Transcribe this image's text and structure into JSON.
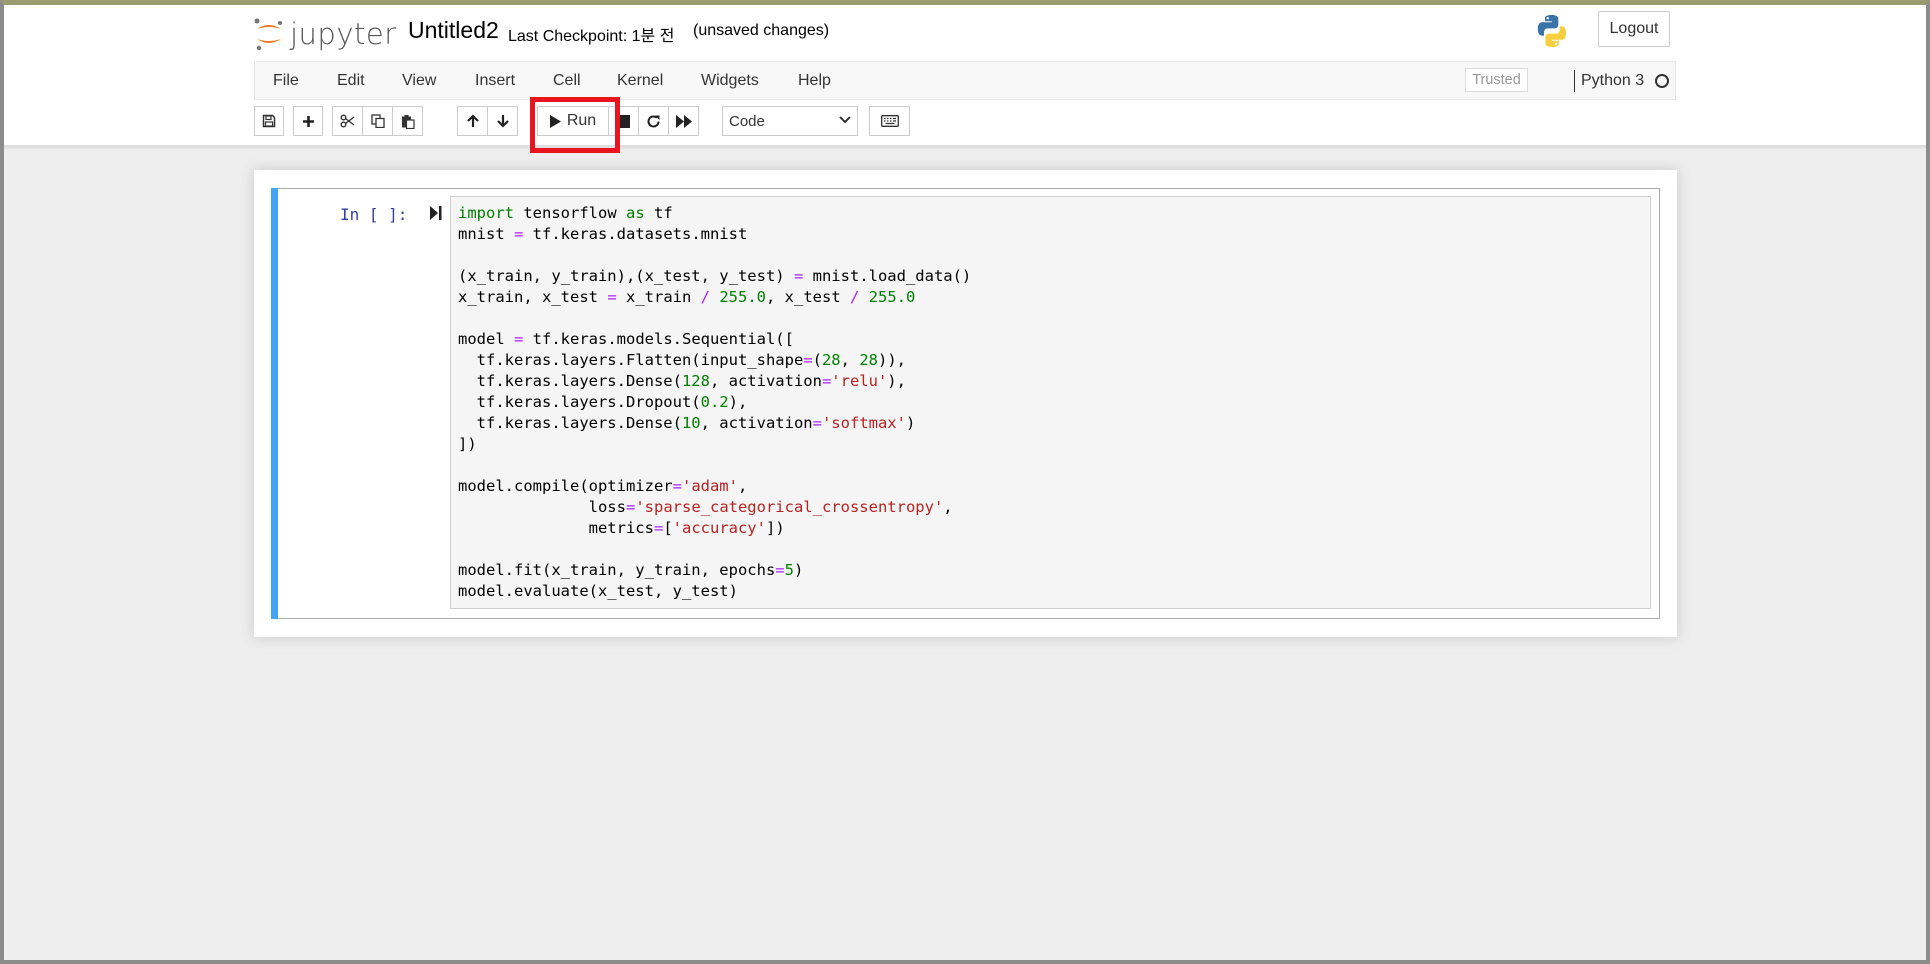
{
  "header": {
    "logo_text": "jupyter",
    "notebook_name": "Untitled2",
    "checkpoint": "Last Checkpoint: 1분 전",
    "autosave_status": "(unsaved changes)",
    "logout_label": "Logout"
  },
  "menubar": {
    "items": [
      "File",
      "Edit",
      "View",
      "Insert",
      "Cell",
      "Kernel",
      "Widgets",
      "Help"
    ],
    "trusted_label": "Trusted",
    "kernel_name": "Python 3"
  },
  "toolbar": {
    "buttons": [
      "save-icon",
      "plus-icon",
      "cut-icon",
      "copy-icon",
      "paste-icon",
      "arrow-up-icon",
      "arrow-down-icon",
      "play-icon",
      "stop-icon",
      "restart-icon",
      "fast-forward-icon",
      "keyboard-icon"
    ],
    "run_label": "Run",
    "cell_type": "Code",
    "highlight_color": "#e8141e"
  },
  "cell": {
    "prompt": "In [ ]:",
    "lines": [
      "import tensorflow as tf",
      "mnist = tf.keras.datasets.mnist",
      "",
      "(x_train, y_train),(x_test, y_test) = mnist.load_data()",
      "x_train, x_test = x_train / 255.0, x_test / 255.0",
      "",
      "model = tf.keras.models.Sequential([",
      "  tf.keras.layers.Flatten(input_shape=(28, 28)),",
      "  tf.keras.layers.Dense(128, activation='relu'),",
      "  tf.keras.layers.Dropout(0.2),",
      "  tf.keras.layers.Dense(10, activation='softmax')",
      "])",
      "",
      "model.compile(optimizer='adam',",
      "              loss='sparse_categorical_crossentropy',",
      "              metrics=['accuracy'])",
      "",
      "model.fit(x_train, y_train, epochs=5)",
      "model.evaluate(x_test, y_test)"
    ]
  },
  "colors": {
    "selected_cell_bar": "#42a5f5",
    "prompt": "#303f9f",
    "keyword": "#008000",
    "operator": "#aa22ff",
    "string": "#ba2121"
  }
}
